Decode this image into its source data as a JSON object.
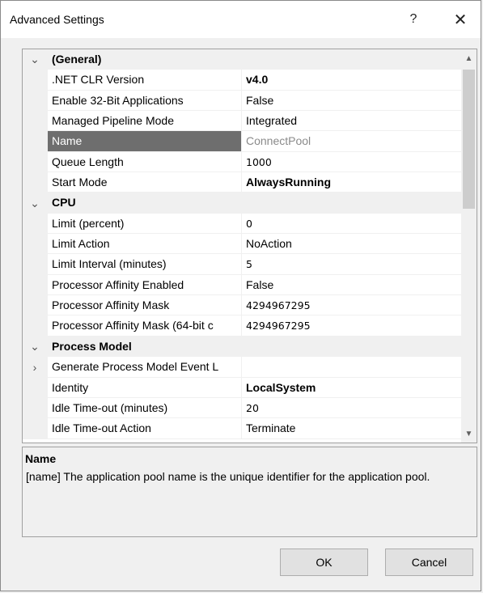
{
  "window": {
    "title": "Advanced Settings",
    "help_glyph": "?",
    "close_glyph": "✕"
  },
  "grid": {
    "rows": [
      {
        "type": "category",
        "label": "(General)",
        "expander": "⌄"
      },
      {
        "type": "prop",
        "name": ".NET CLR Version",
        "value": "v4.0",
        "bold": true
      },
      {
        "type": "prop",
        "name": "Enable 32-Bit Applications",
        "value": "False"
      },
      {
        "type": "prop",
        "name": "Managed Pipeline Mode",
        "value": "Integrated"
      },
      {
        "type": "prop",
        "name": "Name",
        "value": "ConnectPool",
        "selected": true
      },
      {
        "type": "prop",
        "name": "Queue Length",
        "value": "1000"
      },
      {
        "type": "prop",
        "name": "Start Mode",
        "value": "AlwaysRunning",
        "bold": true
      },
      {
        "type": "category",
        "label": "CPU",
        "expander": "⌄"
      },
      {
        "type": "prop",
        "name": "Limit (percent)",
        "value": "0"
      },
      {
        "type": "prop",
        "name": "Limit Action",
        "value": "NoAction"
      },
      {
        "type": "prop",
        "name": "Limit Interval (minutes)",
        "value": "5"
      },
      {
        "type": "prop",
        "name": "Processor Affinity Enabled",
        "value": "False"
      },
      {
        "type": "prop",
        "name": "Processor Affinity Mask",
        "value": "4294967295"
      },
      {
        "type": "prop",
        "name": "Processor Affinity Mask (64-bit c",
        "value": "4294967295"
      },
      {
        "type": "category",
        "label": "Process Model",
        "expander": "⌄"
      },
      {
        "type": "prop",
        "name": "Generate Process Model Event L",
        "value": "",
        "expander": "›"
      },
      {
        "type": "prop",
        "name": "Identity",
        "value": "LocalSystem",
        "bold": true
      },
      {
        "type": "prop",
        "name": "Idle Time-out (minutes)",
        "value": "20"
      },
      {
        "type": "prop",
        "name": "Idle Time-out Action",
        "value": "Terminate"
      }
    ]
  },
  "description": {
    "title": "Name",
    "text": "[name] The application pool name is the unique identifier for the application pool."
  },
  "buttons": {
    "ok": "OK",
    "cancel": "Cancel"
  }
}
